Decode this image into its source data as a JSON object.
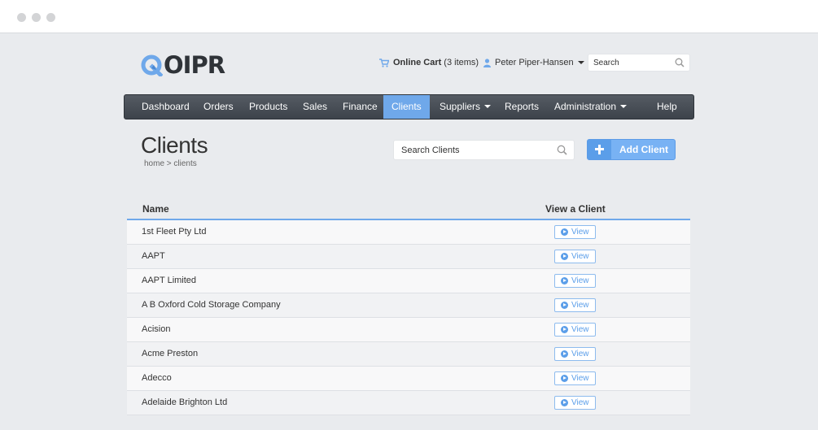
{
  "brand": {
    "logo_text": "OIPR",
    "logo_mark": "Q"
  },
  "header": {
    "cart_label": "Online Cart",
    "cart_items": "(3 items)",
    "user_name": "Peter Piper-Hansen",
    "search_placeholder": "Search"
  },
  "nav": {
    "items": [
      {
        "label": "Dashboard"
      },
      {
        "label": "Orders"
      },
      {
        "label": "Products"
      },
      {
        "label": "Sales"
      },
      {
        "label": "Finance"
      },
      {
        "label": "Clients",
        "active": true
      },
      {
        "label": "Suppliers",
        "dropdown": true
      },
      {
        "label": "Reports"
      },
      {
        "label": "Administration",
        "dropdown": true
      },
      {
        "label": "Help"
      }
    ]
  },
  "page": {
    "title": "Clients",
    "breadcrumb": "home > clients",
    "search_placeholder": "Search Clients",
    "add_button_label": "Add Client"
  },
  "table": {
    "columns": [
      "Name",
      "View a Client"
    ],
    "view_label": "View",
    "rows": [
      {
        "name": "1st Fleet Pty Ltd"
      },
      {
        "name": "AAPT"
      },
      {
        "name": "AAPT Limited"
      },
      {
        "name": "A B Oxford Cold Storage Company"
      },
      {
        "name": "Acision"
      },
      {
        "name": "Acme Preston"
      },
      {
        "name": "Adecco"
      },
      {
        "name": "Adelaide Brighton Ltd"
      }
    ]
  },
  "colors": {
    "accent": "#6fa8ea",
    "navbar": "#4a5058",
    "button": "#78b2f4",
    "logo_mark": "#6fa8ea"
  },
  "icons": {
    "window_controls": [
      "window-dot-icon",
      "window-dot-icon",
      "window-dot-icon"
    ],
    "cart": "cart-icon",
    "user": "user-icon",
    "search": "search-icon",
    "add": "plus-icon",
    "view": "arrow-circle-right-icon"
  }
}
